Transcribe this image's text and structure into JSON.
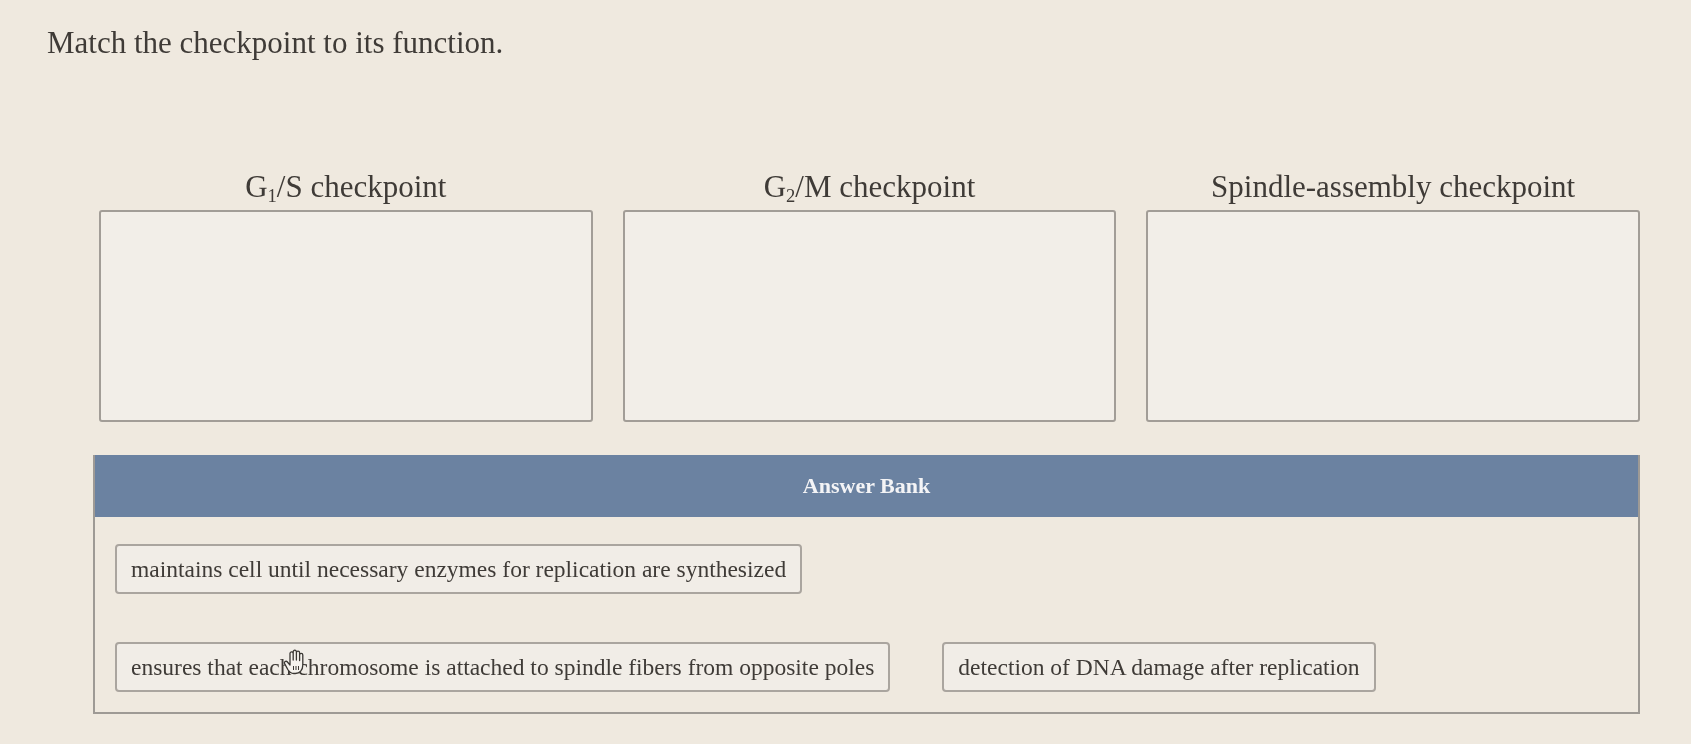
{
  "instruction": "Match the checkpoint to its function.",
  "targets": [
    {
      "label": "G$_{1}$/S checkpoint"
    },
    {
      "label": "G$_{2}$/M checkpoint"
    },
    {
      "label": "Spindle-assembly checkpoint"
    }
  ],
  "answer_bank": {
    "title": "Answer Bank",
    "rows": [
      {
        "cards": [
          "maintains cell until necessary enzymes for replication are synthesized"
        ]
      },
      {
        "cards": [
          "ensures that each chromosome is attached to spindle fibers from opposite poles",
          "detection of DNA damage after replication"
        ]
      }
    ]
  }
}
